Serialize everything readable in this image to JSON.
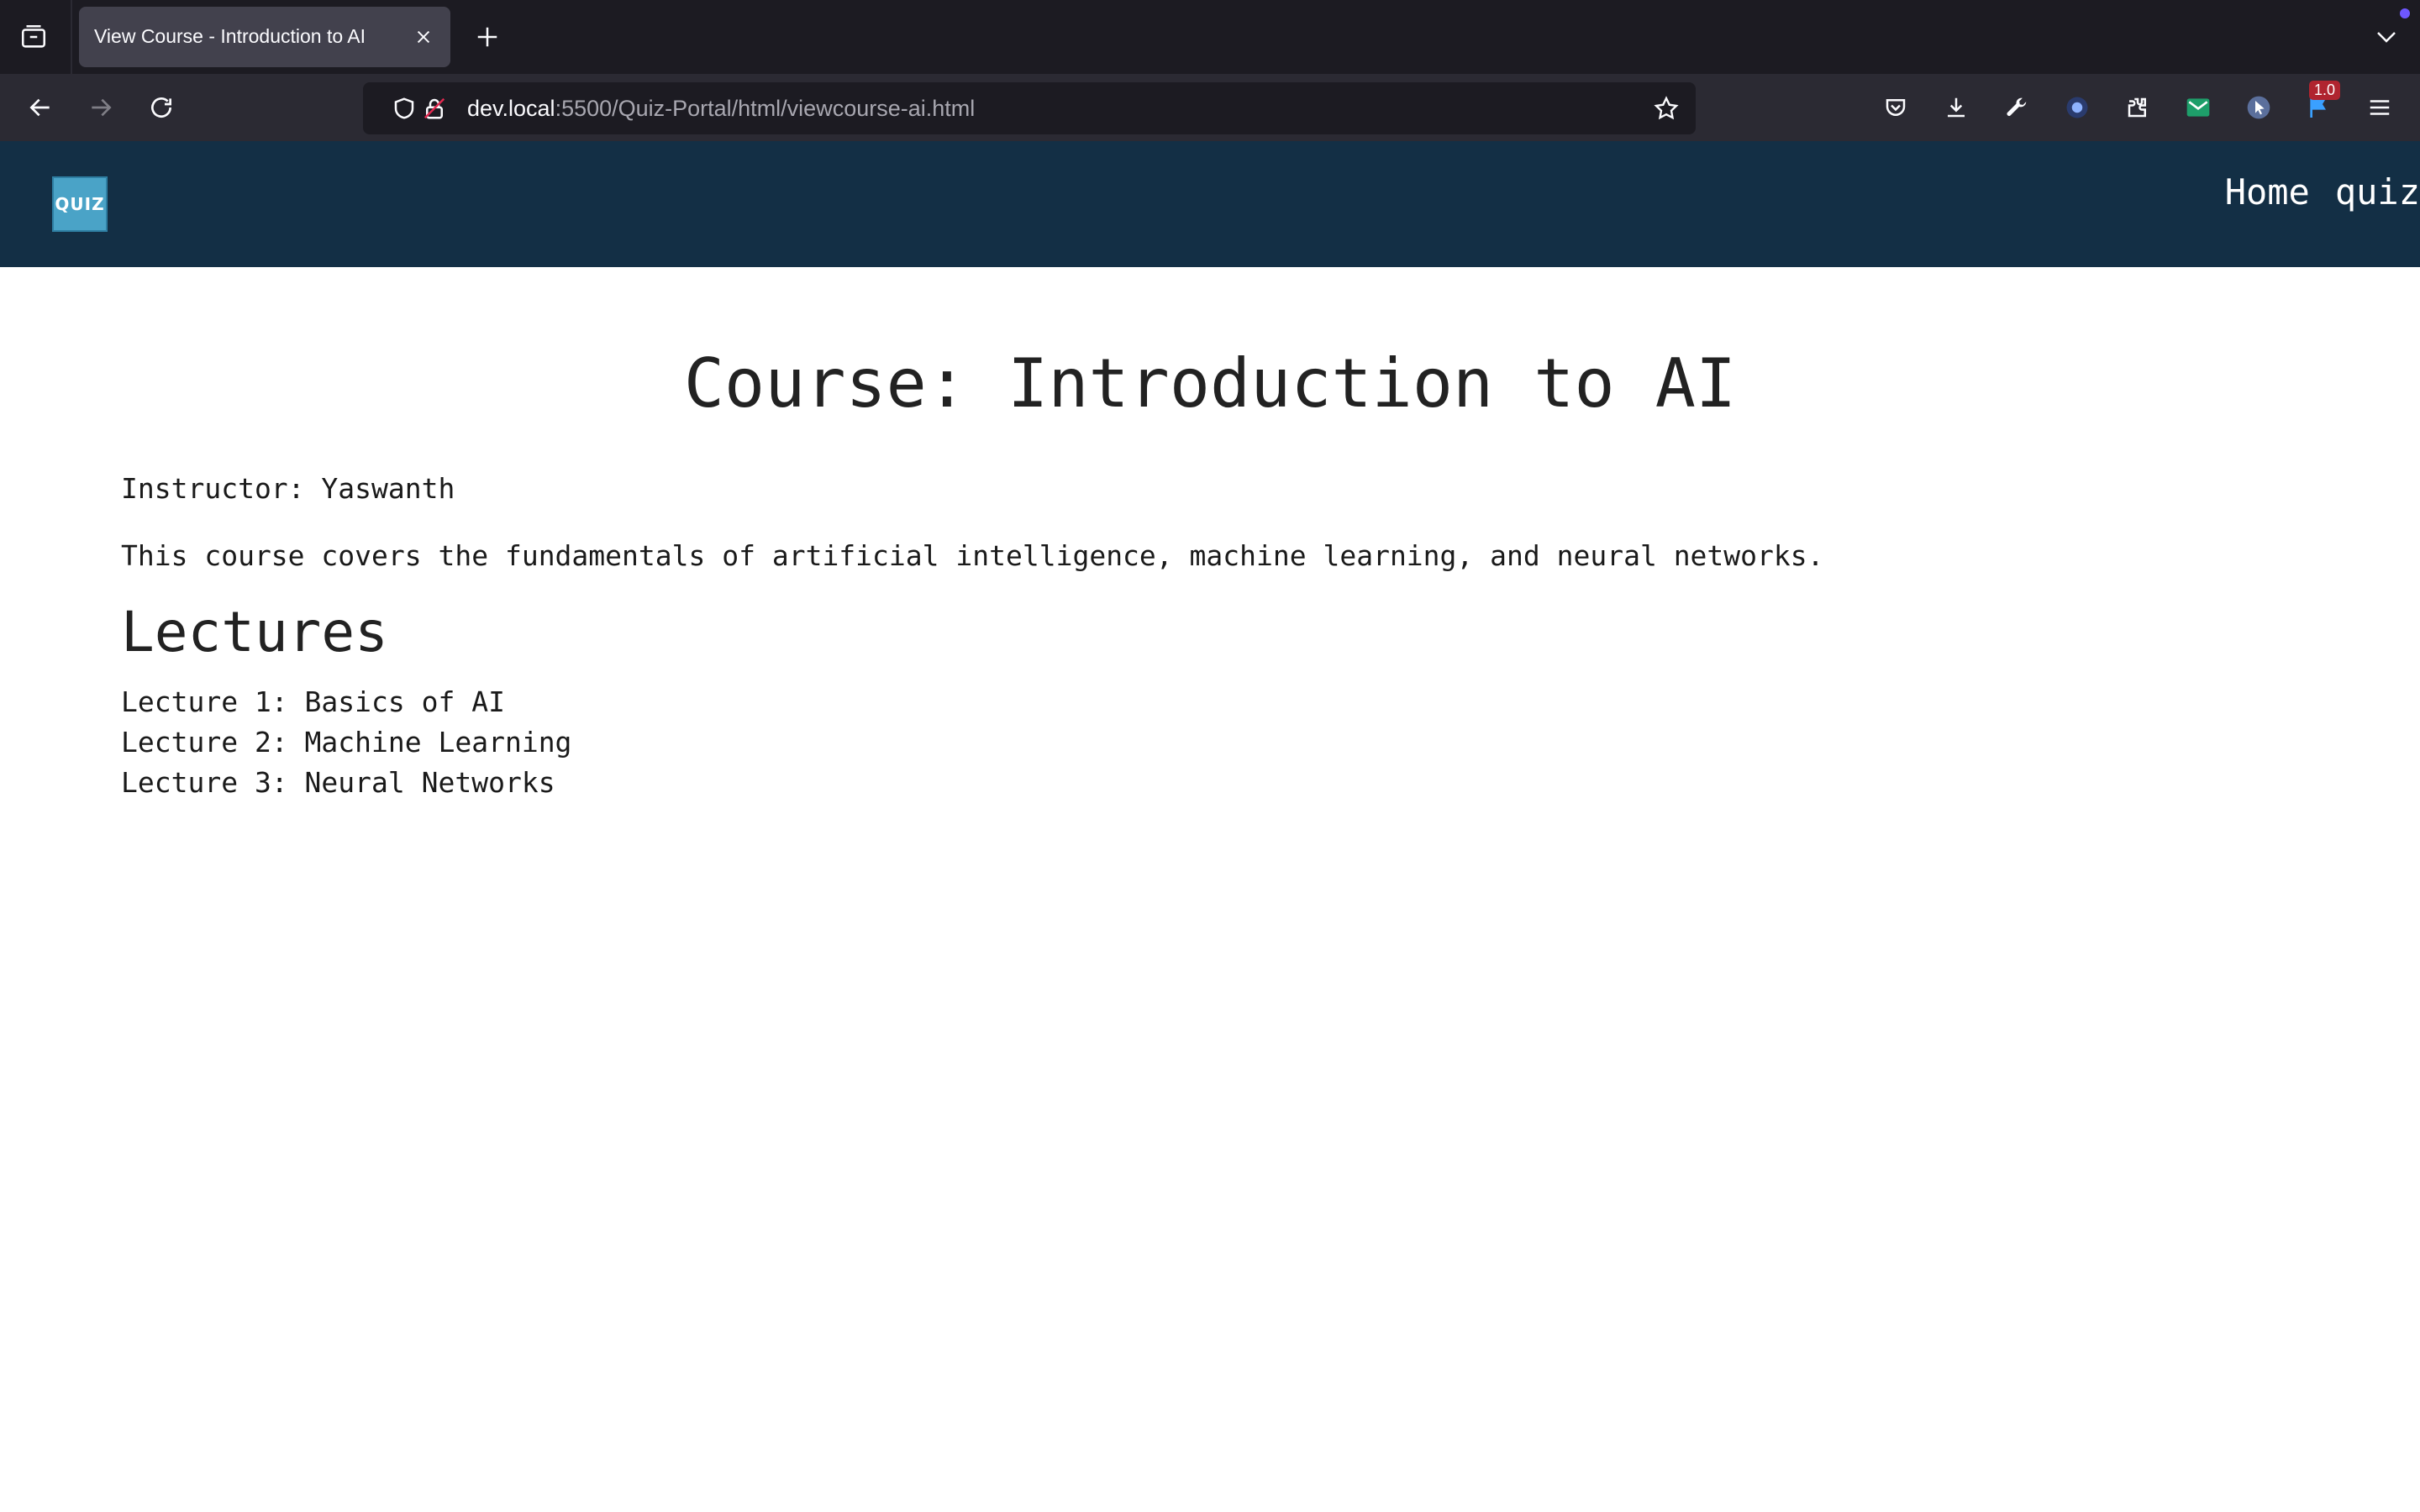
{
  "browser": {
    "tab_title": "View Course - Introduction to AI",
    "url_host": "dev.local",
    "url_rest": ":5500/Quiz-Portal/html/viewcourse-ai.html",
    "extension_badge": "1.0",
    "icons": [
      "tab-list-icon",
      "close-icon",
      "plus-icon",
      "chevron-down-icon",
      "back-arrow-icon",
      "forward-arrow-icon",
      "reload-icon",
      "shield-icon",
      "lock-icon",
      "star-icon",
      "pocket-icon",
      "download-icon",
      "wrench-icon",
      "extension-icon",
      "puzzle-icon",
      "mail-icon",
      "cursor-icon",
      "flag-icon",
      "menu-icon"
    ]
  },
  "header": {
    "logo_text": "QUIZ",
    "nav": [
      {
        "label": "Home"
      },
      {
        "label": "quiz"
      }
    ]
  },
  "main": {
    "title": "Course: Introduction to AI",
    "instructor": "Instructor: Yaswanth",
    "description": "This course covers the fundamentals of artificial intelligence, machine learning, and neural networks.",
    "lectures_heading": "Lectures",
    "lectures": [
      "Lecture 1: Basics of AI",
      "Lecture 2: Machine Learning",
      "Lecture 3: Neural Networks"
    ]
  },
  "colors": {
    "header_bg": "#132f45",
    "chrome_dark": "#1c1b22",
    "chrome_nav": "#2b2a33"
  }
}
